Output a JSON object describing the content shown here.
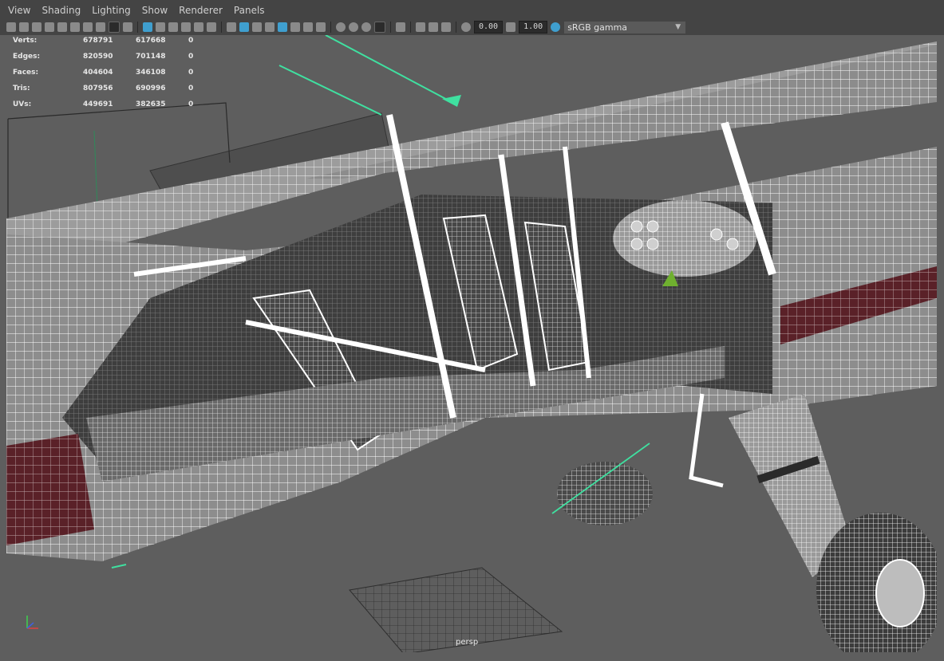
{
  "menubar": {
    "items": [
      "View",
      "Shading",
      "Lighting",
      "Show",
      "Renderer",
      "Panels"
    ]
  },
  "toolbar": {
    "exposure_value": "0.00",
    "gamma_value": "1.00",
    "color_space": "sRGB gamma",
    "icons": [
      "select-camera-icon",
      "camera-attributes-icon",
      "bookmark-icon",
      "image-plane-icon",
      "grid-icon",
      "film-gate-icon",
      "resolution-gate-icon",
      "gate-mask-icon",
      "field-chart-icon",
      "safe-action-icon",
      "wireframe-icon",
      "smooth-shade-icon",
      "wireframe-on-shaded-icon",
      "textured-icon",
      "lighting-icon",
      "shadows-icon",
      "ambient-occlusion-icon",
      "motion-blur-icon",
      "anti-aliasing-icon",
      "depth-of-field-icon",
      "isolate-select-icon",
      "xray-icon",
      "xray-joints-icon",
      "xray-active-icon",
      "exposure-icon",
      "gamma-icon",
      "color-management-icon"
    ]
  },
  "hud": {
    "rows": [
      {
        "label": "Verts:",
        "v1": "678791",
        "v2": "617668",
        "v3": "0"
      },
      {
        "label": "Edges:",
        "v1": "820590",
        "v2": "701148",
        "v3": "0"
      },
      {
        "label": "Faces:",
        "v1": "404604",
        "v2": "346108",
        "v3": "0"
      },
      {
        "label": "Tris:",
        "v1": "807956",
        "v2": "690996",
        "v3": "0"
      },
      {
        "label": "UVs:",
        "v1": "449691",
        "v2": "382635",
        "v3": "0"
      }
    ]
  },
  "viewport": {
    "camera_label": "persp",
    "background_color": "#5e5e5e",
    "wire_color": "#ffffff",
    "fuselage_stripe_color": "#5a2128",
    "highlight_color": "#3fe0a0"
  }
}
